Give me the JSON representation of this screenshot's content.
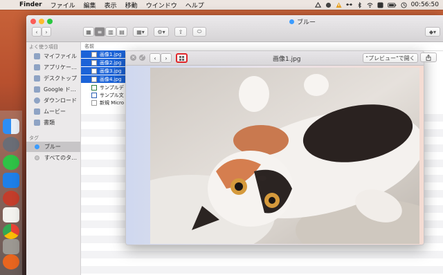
{
  "menubar": {
    "app_name": "Finder",
    "items": [
      "ファイル",
      "編集",
      "表示",
      "移動",
      "ウインドウ",
      "ヘルプ"
    ],
    "clock": "00:56:50"
  },
  "window": {
    "title": "ブルー",
    "back_icon": "chevron-left-icon",
    "forward_icon": "chevron-right-icon"
  },
  "sidebar": {
    "favorites_header": "よく使う項目",
    "favorites": [
      "マイファイル",
      "アプリケー…",
      "デスクトップ",
      "Google ド…",
      "ダウンロード",
      "ムービー",
      "書類"
    ],
    "tags_header": "タグ",
    "tags": [
      {
        "label": "ブルー",
        "color": "#3b9cff"
      },
      {
        "label": "すべてのタ…",
        "color": "#c8c6c8"
      }
    ]
  },
  "filelist": {
    "column_name": "名前",
    "rows": [
      "画像1.jpg",
      "画像2.jpg",
      "画像3.jpg",
      "画像4.jpg",
      "サンプルデ",
      "サンプル文",
      "新規 Micro"
    ]
  },
  "quicklook": {
    "title": "画像1.jpg",
    "open_with_label": "\"プレビュー\"で開く",
    "close_glyph": "×",
    "fullscreen_glyph": "⤢",
    "prev_glyph": "‹",
    "next_glyph": "›",
    "index_sheet_icon": "grid-icon",
    "share_icon": "share-icon"
  },
  "colors": {
    "selection": "#1b63d8",
    "highlight_border": "#e0262a"
  }
}
